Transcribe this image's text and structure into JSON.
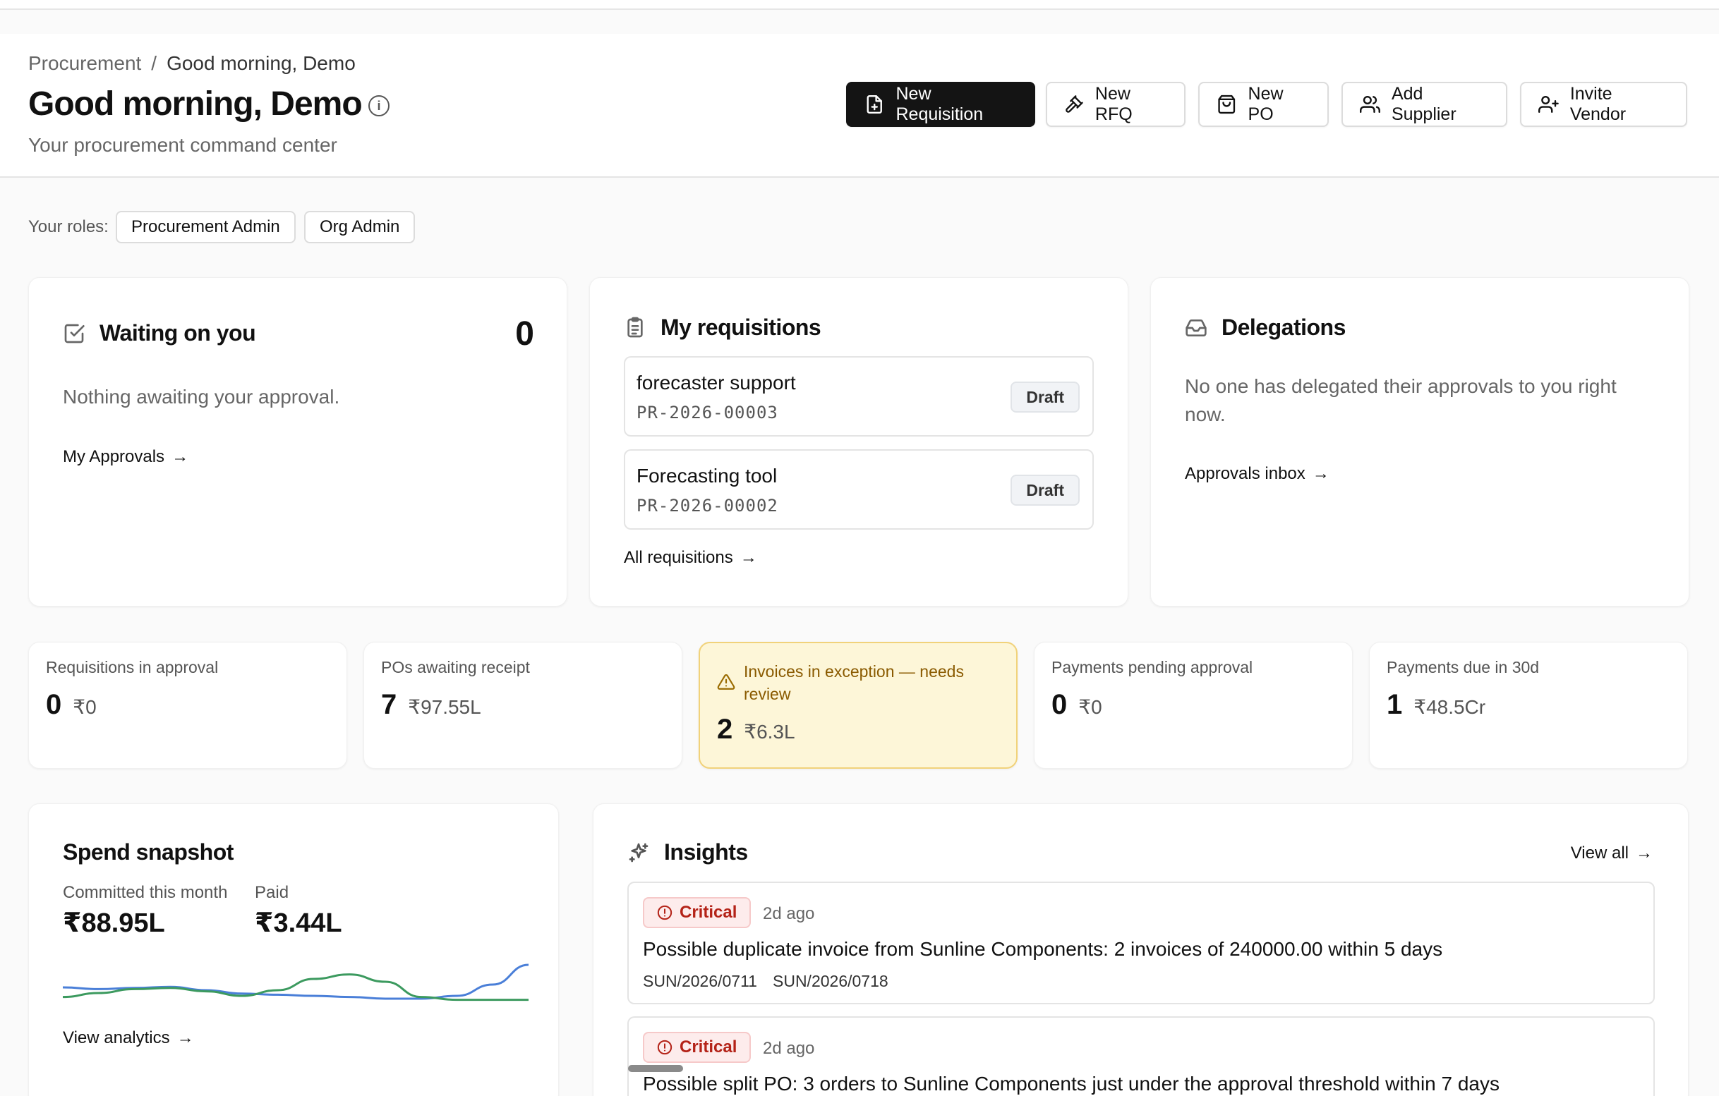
{
  "breadcrumb": {
    "root": "Procurement",
    "separator": "/",
    "current": "Good morning, Demo"
  },
  "page": {
    "title": "Good morning, Demo",
    "subtitle": "Your procurement command center"
  },
  "actions": {
    "new_requisition": "New Requisition",
    "new_rfq": "New RFQ",
    "new_po": "New PO",
    "add_supplier": "Add Supplier",
    "invite_vendor": "Invite Vendor"
  },
  "roles": {
    "label": "Your roles:",
    "items": [
      "Procurement Admin",
      "Org Admin"
    ]
  },
  "waiting": {
    "title": "Waiting on you",
    "count": "0",
    "empty": "Nothing awaiting your approval.",
    "link": "My Approvals"
  },
  "requisitions": {
    "title": "My requisitions",
    "items": [
      {
        "title": "forecaster support",
        "id": "PR-2026-00003",
        "status": "Draft"
      },
      {
        "title": "Forecasting tool",
        "id": "PR-2026-00002",
        "status": "Draft"
      }
    ],
    "link": "All requisitions"
  },
  "delegations": {
    "title": "Delegations",
    "empty": "No one has delegated their approvals to you right now.",
    "link": "Approvals inbox"
  },
  "kpis": [
    {
      "label": "Requisitions in approval",
      "count": "0",
      "amount": "₹0"
    },
    {
      "label": "POs awaiting receipt",
      "count": "7",
      "amount": "₹97.55L"
    },
    {
      "label": "Invoices in exception — needs review",
      "count": "2",
      "amount": "₹6.3L"
    },
    {
      "label": "Payments pending approval",
      "count": "0",
      "amount": "₹0"
    },
    {
      "label": "Payments due in 30d",
      "count": "1",
      "amount": "₹48.5Cr"
    }
  ],
  "spend": {
    "title": "Spend snapshot",
    "committed_label": "Committed this month",
    "committed_value": "₹88.95L",
    "paid_label": "Paid",
    "paid_value": "₹3.44L",
    "link": "View analytics"
  },
  "chart_data": {
    "type": "line",
    "series": [
      {
        "color": "#4a7fd8",
        "values": [
          0.35,
          0.38,
          0.36,
          0.34,
          0.4,
          0.46,
          0.48,
          0.5,
          0.52,
          0.55,
          0.55,
          0.5,
          0.3,
          -0.05
        ]
      },
      {
        "color": "#3c9a5f",
        "values": [
          0.52,
          0.45,
          0.38,
          0.36,
          0.42,
          0.5,
          0.4,
          0.2,
          0.12,
          0.25,
          0.52,
          0.57,
          0.57,
          0.57
        ]
      }
    ]
  },
  "insights": {
    "title": "Insights",
    "view_all": "View all",
    "items": [
      {
        "severity": "Critical",
        "age": "2d ago",
        "text": "Possible duplicate invoice from Sunline Components: 2 invoices of 240000.00 within 5 days",
        "refs": [
          "SUN/2026/0711",
          "SUN/2026/0718"
        ]
      },
      {
        "severity": "Critical",
        "age": "2d ago",
        "text": "Possible split PO: 3 orders to Sunline Components just under the approval threshold within 7 days",
        "refs": []
      }
    ]
  },
  "colors": {
    "primary": "#141414",
    "critical": "#b42318",
    "warning_bg": "#fdf6d8",
    "series_blue": "#4a7fd8",
    "series_green": "#3c9a5f"
  }
}
